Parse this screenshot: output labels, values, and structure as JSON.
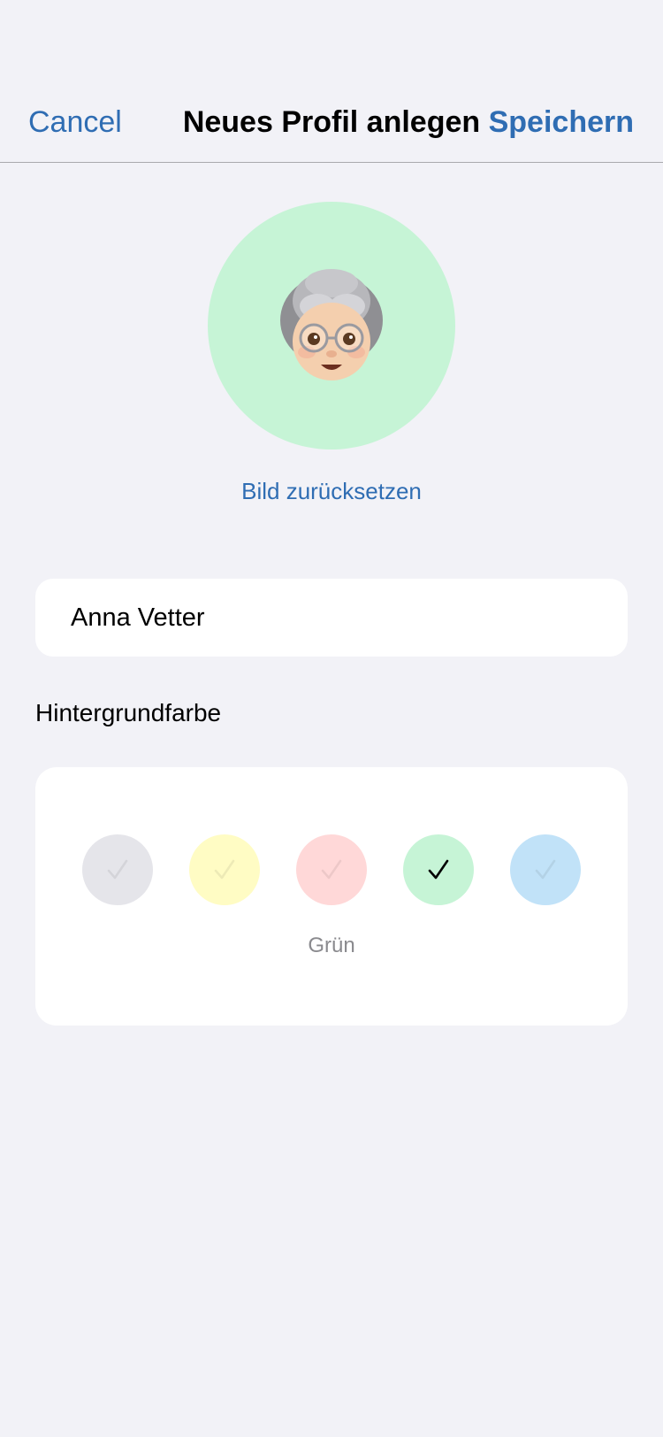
{
  "nav": {
    "cancel_label": "Cancel",
    "title": "Neues Profil anlegen",
    "save_label": "Speichern"
  },
  "avatar": {
    "icon": "grandmother-memoji-icon",
    "background_color": "#c6f4d6"
  },
  "reset_image_label": "Bild zurücksetzen",
  "name_field": {
    "value": "Anna Vetter"
  },
  "background_color_section": {
    "label": "Hintergrundfarbe",
    "selected_color_name": "Grün",
    "swatches": [
      {
        "color": "#e5e5ea",
        "selected": false
      },
      {
        "color": "#fffcc4",
        "selected": false
      },
      {
        "color": "#ffd8d8",
        "selected": false
      },
      {
        "color": "#c6f4d6",
        "selected": true
      },
      {
        "color": "#c1e2f8",
        "selected": false
      }
    ]
  },
  "colors": {
    "accent": "#2f6db3",
    "page_background": "#f2f2f7"
  }
}
